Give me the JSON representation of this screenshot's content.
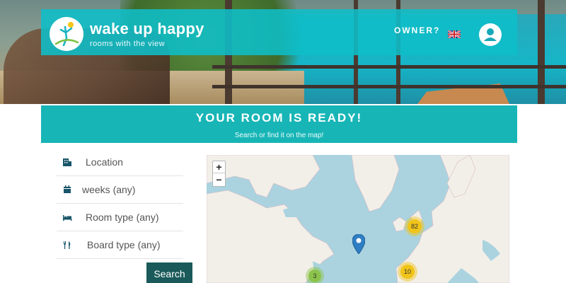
{
  "header": {
    "brand": "wake up happy",
    "tagline": "rooms with the view",
    "owner_link": "OWNER?"
  },
  "banner": {
    "title": "YOUR ROOM IS READY!",
    "subtitle": "Search or find it on the map!"
  },
  "search": {
    "fields": [
      {
        "label": "Location",
        "icon": "building-icon"
      },
      {
        "label": "weeks (any)",
        "icon": "calendar-icon"
      },
      {
        "label": "Room type (any)",
        "icon": "bed-icon"
      },
      {
        "label": "Board type (any)",
        "icon": "cutlery-icon"
      }
    ],
    "button_label": "Search"
  },
  "map": {
    "zoom_in": "+",
    "zoom_out": "−",
    "clusters": [
      {
        "count": "82",
        "color": "#f0c419"
      },
      {
        "count": "10",
        "color": "#f0c419"
      },
      {
        "count": "3",
        "color": "#8bc34a"
      }
    ]
  },
  "colors": {
    "header_bg": "#0ebec8",
    "banner_bg": "#17b5b6",
    "button_bg": "#1a5a5a",
    "map_water": "#aad3df",
    "map_land": "#f2efe9"
  }
}
